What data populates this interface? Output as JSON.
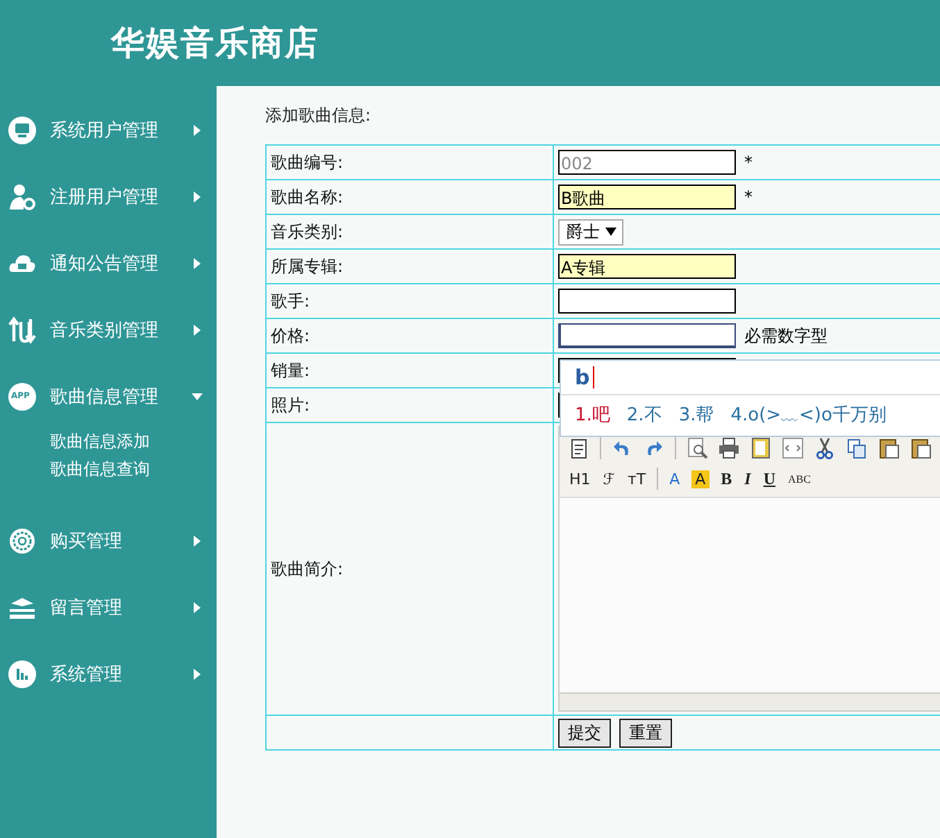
{
  "header": {
    "title": "华娱音乐商店"
  },
  "sidebar": {
    "items": [
      {
        "label": "系统用户管理",
        "kind": "monitor",
        "expanded": false
      },
      {
        "label": "注册用户管理",
        "kind": "user-gear",
        "expanded": false
      },
      {
        "label": "通知公告管理",
        "kind": "cloud",
        "expanded": false
      },
      {
        "label": "音乐类别管理",
        "kind": "arrows",
        "expanded": false
      },
      {
        "label": "歌曲信息管理",
        "kind": "app",
        "badge": "APP",
        "expanded": true,
        "children": [
          {
            "label": "歌曲信息添加"
          },
          {
            "label": "歌曲信息查询"
          }
        ]
      },
      {
        "label": "购买管理",
        "kind": "gear",
        "expanded": false
      },
      {
        "label": "留言管理",
        "kind": "layers",
        "expanded": false
      },
      {
        "label": "系统管理",
        "kind": "chart",
        "expanded": false
      }
    ]
  },
  "form": {
    "heading": "添加歌曲信息:",
    "rows": [
      {
        "label": "歌曲编号:",
        "kind": "text",
        "placeholder": "002",
        "highlighted": false,
        "focused": false,
        "note": "*"
      },
      {
        "label": "歌曲名称:",
        "kind": "text",
        "value": "B歌曲",
        "highlighted": true,
        "focused": false,
        "note": "*"
      },
      {
        "label": "音乐类别:",
        "kind": "select",
        "value": "爵士"
      },
      {
        "label": "所属专辑:",
        "kind": "text",
        "value": "A专辑",
        "highlighted": true,
        "focused": false
      },
      {
        "label": "歌手:",
        "kind": "text",
        "highlighted": false,
        "focused": false
      },
      {
        "label": "价格:",
        "kind": "text",
        "highlighted": false,
        "focused": true,
        "note": "必需数字型"
      },
      {
        "label": "销量:",
        "kind": "text"
      },
      {
        "label": "照片:",
        "kind": "text"
      },
      {
        "label": "歌曲简介:",
        "kind": "editor"
      }
    ],
    "editor_buttons": [
      {
        "label": "H1",
        "kind": "dropdown"
      },
      {
        "label": "ℱ",
        "kind": "dropdown"
      },
      {
        "label": "тT",
        "kind": "dropdown"
      },
      {
        "label": "A",
        "kind": "font-color"
      },
      {
        "label": "A",
        "kind": "highlight"
      },
      {
        "label": "B",
        "kind": "bold"
      },
      {
        "label": "I",
        "kind": "italic"
      },
      {
        "label": "U",
        "kind": "underline"
      },
      {
        "label": "ABC",
        "kind": "strike"
      }
    ],
    "buttons": [
      "提交",
      "重置"
    ]
  },
  "ime": {
    "input": "b",
    "candidates": [
      {
        "label": "1.吧",
        "selected": true
      },
      {
        "label": "2.不",
        "selected": false
      },
      {
        "label": "3.帮",
        "selected": false
      },
      {
        "label": "4.o(>﹏<)o千万别",
        "selected": false
      }
    ]
  }
}
